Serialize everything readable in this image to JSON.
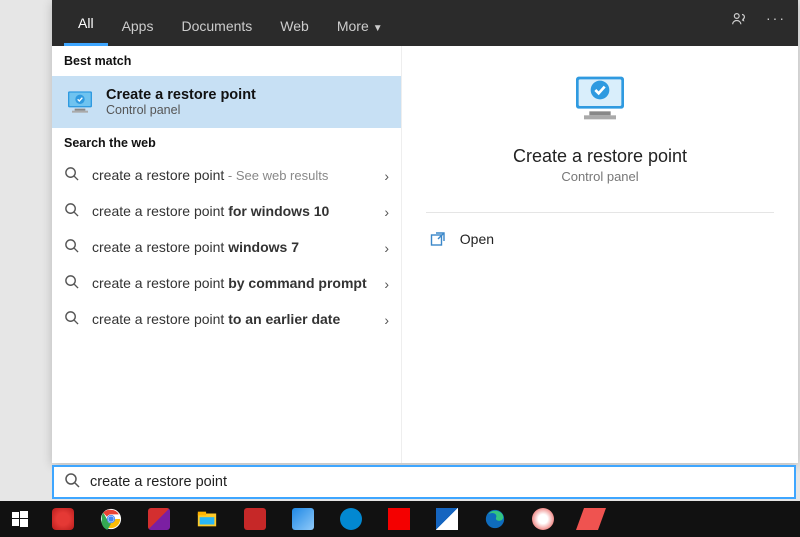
{
  "tabs": {
    "all": "All",
    "apps": "Apps",
    "documents": "Documents",
    "web": "Web",
    "more": "More"
  },
  "sections": {
    "best_match": "Best match",
    "search_web": "Search the web"
  },
  "best_match": {
    "title": "Create a restore point",
    "subtitle": "Control panel"
  },
  "web_results": [
    {
      "prefix": "create a restore point",
      "bold": "",
      "hint": " - See web results"
    },
    {
      "prefix": "create a restore point ",
      "bold": "for windows 10",
      "hint": ""
    },
    {
      "prefix": "create a restore point ",
      "bold": "windows 7",
      "hint": ""
    },
    {
      "prefix": "create a restore point ",
      "bold": "by command prompt",
      "hint": ""
    },
    {
      "prefix": "create a restore point ",
      "bold": "to an earlier date",
      "hint": ""
    }
  ],
  "detail": {
    "title": "Create a restore point",
    "subtitle": "Control panel",
    "open": "Open"
  },
  "search": {
    "value": "create a restore point"
  }
}
